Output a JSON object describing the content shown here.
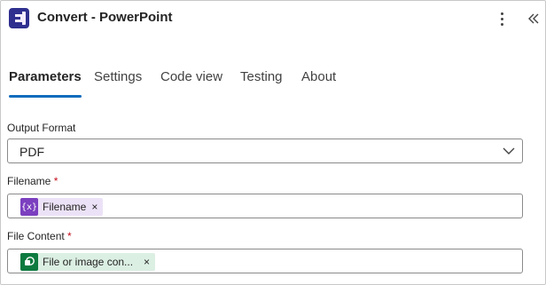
{
  "header": {
    "title": "Convert - PowerPoint"
  },
  "tabs": [
    {
      "label": "Parameters",
      "active": true
    },
    {
      "label": "Settings"
    },
    {
      "label": "Code view"
    },
    {
      "label": "Testing"
    },
    {
      "label": "About"
    }
  ],
  "fields": {
    "output_format": {
      "label": "Output Format",
      "value": "PDF"
    },
    "filename": {
      "label": "Filename",
      "required_mark": "*",
      "token": {
        "icon_text": "{x}",
        "label": "Filename",
        "close": "×"
      }
    },
    "file_content": {
      "label": "File Content",
      "required_mark": "*",
      "token": {
        "label": "File or image con...",
        "close": "×"
      }
    }
  },
  "colors": {
    "accent": "#0f6cbd",
    "required": "#c50f1f",
    "token_purple": "#7b3fbf",
    "token_green": "#0d7a3f"
  }
}
